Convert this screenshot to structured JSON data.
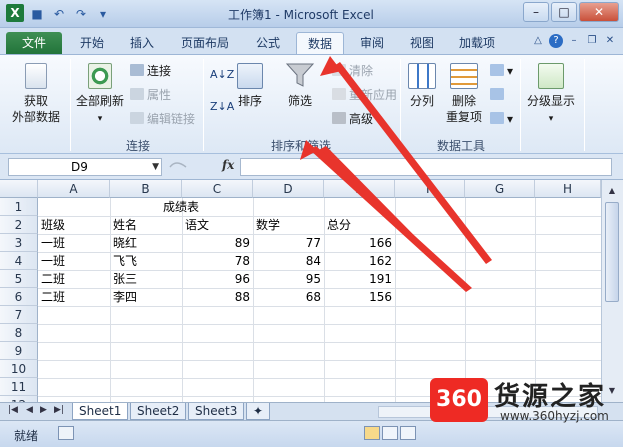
{
  "window": {
    "title": "工作簿1 - Microsoft Excel",
    "app_icon": "X"
  },
  "tabs": [
    {
      "label": "文件"
    },
    {
      "label": "开始"
    },
    {
      "label": "插入"
    },
    {
      "label": "页面布局"
    },
    {
      "label": "公式"
    },
    {
      "label": "数据"
    },
    {
      "label": "审阅"
    },
    {
      "label": "视图"
    },
    {
      "label": "加载项"
    }
  ],
  "ribbon": {
    "get_external": "获取\n外部数据",
    "refresh_all": "全部刷新",
    "connections": "连接",
    "properties": "属性",
    "edit_links": "编辑链接",
    "group_connections": "连接",
    "sort_asc": "A↓Z",
    "sort_desc": "Z↓A",
    "sort": "排序",
    "filter": "筛选",
    "clear": "清除",
    "reapply": "重新应用",
    "advanced": "高级",
    "group_sort_filter": "排序和筛选",
    "text_to_columns": "分列",
    "remove_duplicates": "删除\n重复项",
    "group_data_tools": "数据工具",
    "outline": "分级显示"
  },
  "formula_bar": {
    "name_box": "D9",
    "fx": "fx",
    "value": ""
  },
  "columns": [
    "A",
    "B",
    "C",
    "D",
    "E",
    "F",
    "G",
    "H"
  ],
  "rows": [
    "1",
    "2",
    "3",
    "4",
    "5",
    "6",
    "7",
    "8",
    "9",
    "10",
    "11",
    "12"
  ],
  "cells": {
    "title": "成绩表",
    "headers": [
      "班级",
      "姓名",
      "语文",
      "数学",
      "总分"
    ],
    "data": [
      [
        "一班",
        "晓红",
        "89",
        "77",
        "166"
      ],
      [
        "一班",
        "飞飞",
        "78",
        "84",
        "162"
      ],
      [
        "二班",
        "张三",
        "96",
        "95",
        "191"
      ],
      [
        "二班",
        "李四",
        "88",
        "68",
        "156"
      ]
    ]
  },
  "sheets": [
    "Sheet1",
    "Sheet2",
    "Sheet3"
  ],
  "status": {
    "ready": "就绪"
  },
  "watermark": {
    "logo": "360",
    "name": "货源之家",
    "url": "www.360hyzj.com"
  },
  "colors": {
    "accent": "#1d7a3c",
    "arrow": "#e8342c"
  }
}
